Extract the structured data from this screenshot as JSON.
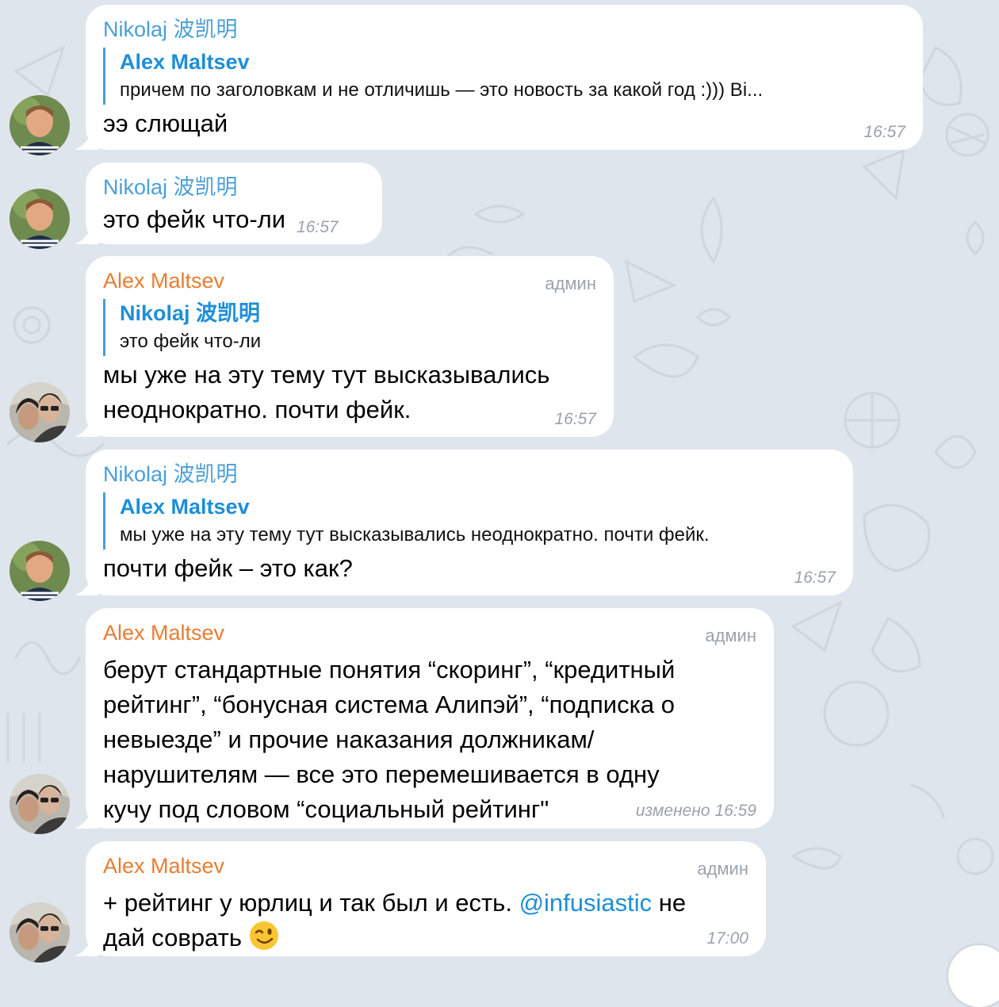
{
  "messages": [
    {
      "sender": "Nikolaj 波凯明",
      "reply": {
        "author": "Alex Maltsev",
        "text": "причем по заголовкам  и не отличишь — это новость за какой год :))) Bi..."
      },
      "text": "ээ слющай",
      "time": "16:57"
    },
    {
      "sender": "Nikolaj 波凯明",
      "text": "это фейк что-ли",
      "time": "16:57"
    },
    {
      "sender": "Alex Maltsev",
      "badge": "админ",
      "reply": {
        "author": "Nikolaj 波凯明",
        "text": "это фейк что-ли"
      },
      "text_line1": "мы уже на эту тему тут высказывались",
      "text_line2": "неоднократно. почти фейк.",
      "time": "16:57"
    },
    {
      "sender": "Nikolaj 波凯明",
      "reply": {
        "author": "Alex Maltsev",
        "text": "мы уже на эту тему тут высказывались неоднократно. почти фейк."
      },
      "text": "почти фейк – это как?",
      "time": "16:57"
    },
    {
      "sender": "Alex Maltsev",
      "badge": "админ",
      "lines": [
        "берут стандартные понятия “скоринг”, “кредитный",
        "рейтинг”, “бонусная система Алипэй”, “подписка о",
        "невыезде” и прочие наказания должникам/",
        "нарушителям — все это перемешивается в одну",
        "кучу под словом “социальный рейтинг\""
      ],
      "edited_label": "изменено",
      "time": "16:59"
    },
    {
      "sender": "Alex Maltsev",
      "badge": "админ",
      "text_start": "+ рейтинг у юрлиц и так был и есть.",
      "mention": "@infusiastic",
      "text_end": "не",
      "text_line2": "дай соврать",
      "emoji": "winking-face",
      "time": "17:00"
    }
  ],
  "colors": {
    "background": "#dfe5ec",
    "bubble": "#ffffff",
    "member_name": "#4a9fd6",
    "admin_name": "#ea7c2f",
    "reply_author": "#1e8ed8",
    "meta": "#9aa3ab"
  }
}
